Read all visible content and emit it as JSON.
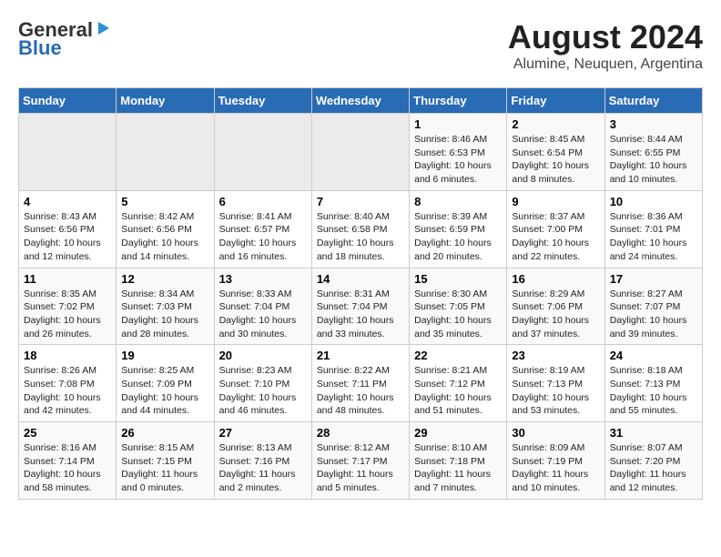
{
  "header": {
    "logo_general": "General",
    "logo_blue": "Blue",
    "month_year": "August 2024",
    "location": "Alumine, Neuquen, Argentina"
  },
  "weekdays": [
    "Sunday",
    "Monday",
    "Tuesday",
    "Wednesday",
    "Thursday",
    "Friday",
    "Saturday"
  ],
  "weeks": [
    [
      {
        "day": "",
        "info": ""
      },
      {
        "day": "",
        "info": ""
      },
      {
        "day": "",
        "info": ""
      },
      {
        "day": "",
        "info": ""
      },
      {
        "day": "1",
        "info": "Sunrise: 8:46 AM\nSunset: 6:53 PM\nDaylight: 10 hours\nand 6 minutes."
      },
      {
        "day": "2",
        "info": "Sunrise: 8:45 AM\nSunset: 6:54 PM\nDaylight: 10 hours\nand 8 minutes."
      },
      {
        "day": "3",
        "info": "Sunrise: 8:44 AM\nSunset: 6:55 PM\nDaylight: 10 hours\nand 10 minutes."
      }
    ],
    [
      {
        "day": "4",
        "info": "Sunrise: 8:43 AM\nSunset: 6:56 PM\nDaylight: 10 hours\nand 12 minutes."
      },
      {
        "day": "5",
        "info": "Sunrise: 8:42 AM\nSunset: 6:56 PM\nDaylight: 10 hours\nand 14 minutes."
      },
      {
        "day": "6",
        "info": "Sunrise: 8:41 AM\nSunset: 6:57 PM\nDaylight: 10 hours\nand 16 minutes."
      },
      {
        "day": "7",
        "info": "Sunrise: 8:40 AM\nSunset: 6:58 PM\nDaylight: 10 hours\nand 18 minutes."
      },
      {
        "day": "8",
        "info": "Sunrise: 8:39 AM\nSunset: 6:59 PM\nDaylight: 10 hours\nand 20 minutes."
      },
      {
        "day": "9",
        "info": "Sunrise: 8:37 AM\nSunset: 7:00 PM\nDaylight: 10 hours\nand 22 minutes."
      },
      {
        "day": "10",
        "info": "Sunrise: 8:36 AM\nSunset: 7:01 PM\nDaylight: 10 hours\nand 24 minutes."
      }
    ],
    [
      {
        "day": "11",
        "info": "Sunrise: 8:35 AM\nSunset: 7:02 PM\nDaylight: 10 hours\nand 26 minutes."
      },
      {
        "day": "12",
        "info": "Sunrise: 8:34 AM\nSunset: 7:03 PM\nDaylight: 10 hours\nand 28 minutes."
      },
      {
        "day": "13",
        "info": "Sunrise: 8:33 AM\nSunset: 7:04 PM\nDaylight: 10 hours\nand 30 minutes."
      },
      {
        "day": "14",
        "info": "Sunrise: 8:31 AM\nSunset: 7:04 PM\nDaylight: 10 hours\nand 33 minutes."
      },
      {
        "day": "15",
        "info": "Sunrise: 8:30 AM\nSunset: 7:05 PM\nDaylight: 10 hours\nand 35 minutes."
      },
      {
        "day": "16",
        "info": "Sunrise: 8:29 AM\nSunset: 7:06 PM\nDaylight: 10 hours\nand 37 minutes."
      },
      {
        "day": "17",
        "info": "Sunrise: 8:27 AM\nSunset: 7:07 PM\nDaylight: 10 hours\nand 39 minutes."
      }
    ],
    [
      {
        "day": "18",
        "info": "Sunrise: 8:26 AM\nSunset: 7:08 PM\nDaylight: 10 hours\nand 42 minutes."
      },
      {
        "day": "19",
        "info": "Sunrise: 8:25 AM\nSunset: 7:09 PM\nDaylight: 10 hours\nand 44 minutes."
      },
      {
        "day": "20",
        "info": "Sunrise: 8:23 AM\nSunset: 7:10 PM\nDaylight: 10 hours\nand 46 minutes."
      },
      {
        "day": "21",
        "info": "Sunrise: 8:22 AM\nSunset: 7:11 PM\nDaylight: 10 hours\nand 48 minutes."
      },
      {
        "day": "22",
        "info": "Sunrise: 8:21 AM\nSunset: 7:12 PM\nDaylight: 10 hours\nand 51 minutes."
      },
      {
        "day": "23",
        "info": "Sunrise: 8:19 AM\nSunset: 7:13 PM\nDaylight: 10 hours\nand 53 minutes."
      },
      {
        "day": "24",
        "info": "Sunrise: 8:18 AM\nSunset: 7:13 PM\nDaylight: 10 hours\nand 55 minutes."
      }
    ],
    [
      {
        "day": "25",
        "info": "Sunrise: 8:16 AM\nSunset: 7:14 PM\nDaylight: 10 hours\nand 58 minutes."
      },
      {
        "day": "26",
        "info": "Sunrise: 8:15 AM\nSunset: 7:15 PM\nDaylight: 11 hours\nand 0 minutes."
      },
      {
        "day": "27",
        "info": "Sunrise: 8:13 AM\nSunset: 7:16 PM\nDaylight: 11 hours\nand 2 minutes."
      },
      {
        "day": "28",
        "info": "Sunrise: 8:12 AM\nSunset: 7:17 PM\nDaylight: 11 hours\nand 5 minutes."
      },
      {
        "day": "29",
        "info": "Sunrise: 8:10 AM\nSunset: 7:18 PM\nDaylight: 11 hours\nand 7 minutes."
      },
      {
        "day": "30",
        "info": "Sunrise: 8:09 AM\nSunset: 7:19 PM\nDaylight: 11 hours\nand 10 minutes."
      },
      {
        "day": "31",
        "info": "Sunrise: 8:07 AM\nSunset: 7:20 PM\nDaylight: 11 hours\nand 12 minutes."
      }
    ]
  ]
}
